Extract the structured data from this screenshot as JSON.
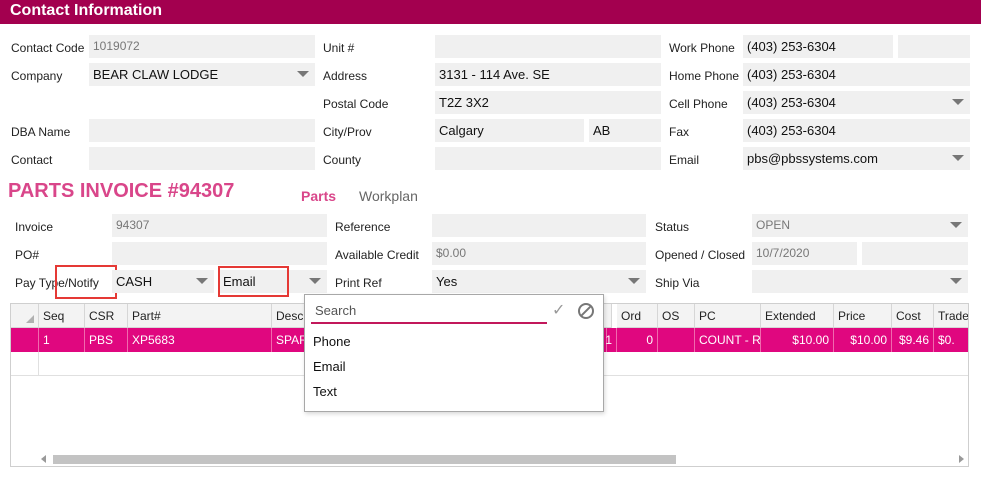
{
  "header": {
    "title": "Contact Information"
  },
  "contact": {
    "contact_code_label": "Contact Code",
    "contact_code": "1019072",
    "company_label": "Company",
    "company": "BEAR CLAW LODGE",
    "dba_label": "DBA Name",
    "dba": "",
    "contact_label": "Contact",
    "contact": "",
    "unit_label": "Unit #",
    "unit": "",
    "address_label": "Address",
    "address": "3131 - 114 Ave. SE",
    "postal_label": "Postal Code",
    "postal": "T2Z 3X2",
    "city_label": "City/Prov",
    "city": "Calgary",
    "prov": "AB",
    "county_label": "County",
    "county": "",
    "work_phone_label": "Work Phone",
    "work_phone": "(403) 253-6304",
    "home_phone_label": "Home Phone",
    "home_phone": "(403) 253-6304",
    "cell_phone_label": "Cell Phone",
    "cell_phone": "(403) 253-6304",
    "fax_label": "Fax",
    "fax": "(403) 253-6304",
    "email_label": "Email",
    "email": "pbs@pbssystems.com"
  },
  "invoice": {
    "title": "PARTS INVOICE #94307",
    "tabs": [
      "Parts",
      "Workplan"
    ],
    "invoice_label": "Invoice",
    "invoice": "94307",
    "po_label": "PO#",
    "po": "",
    "pay_type_label": "Pay Type/Notify",
    "pay_type": "CASH",
    "notify": "Email",
    "reference_label": "Reference",
    "reference": "",
    "available_credit_label": "Available Credit",
    "available_credit": "$0.00",
    "print_ref_label": "Print Ref",
    "print_ref": "Yes",
    "status_label": "Status",
    "status": "OPEN",
    "opened_closed_label": "Opened / Closed",
    "opened": "10/7/2020",
    "closed": "",
    "ship_via_label": "Ship Via",
    "ship_via": ""
  },
  "grid": {
    "columns": [
      "Seq",
      "CSR",
      "Part#",
      "Descr",
      "Ord",
      "OS",
      "PC",
      "Extended",
      "Price",
      "Cost",
      "Trade"
    ],
    "row": {
      "seq": "1",
      "csr": "PBS",
      "part": "XP5683",
      "descr": "SPAR",
      "qty": "1",
      "ord": "0",
      "os": "",
      "pc": "COUNT - R",
      "extended": "$10.00",
      "price": "$10.00",
      "cost": "$9.46",
      "trade": "$0."
    }
  },
  "notify_popup": {
    "search_placeholder": "Search",
    "options": [
      "Phone",
      "Email",
      "Text"
    ]
  }
}
